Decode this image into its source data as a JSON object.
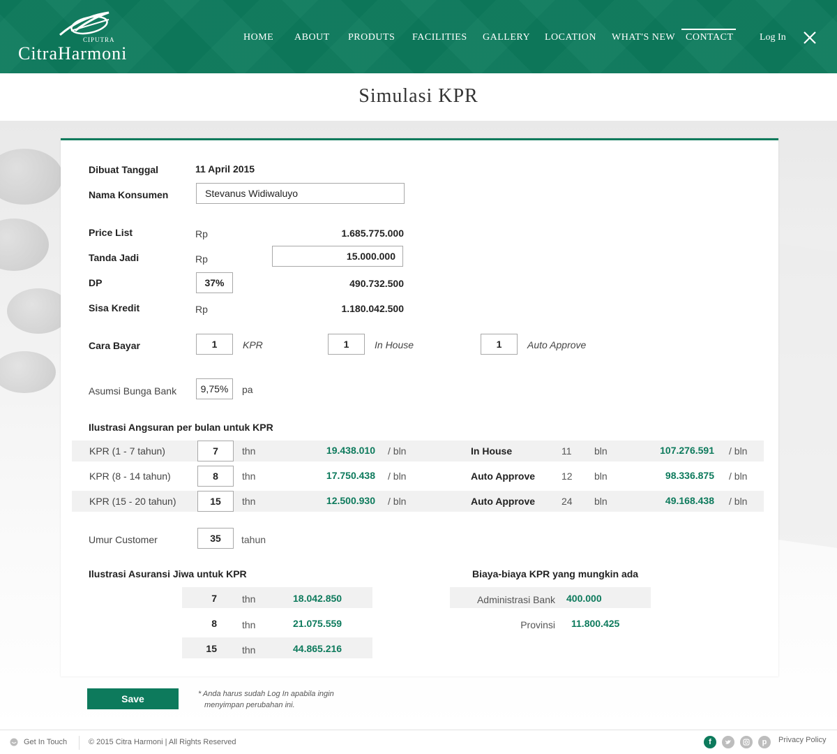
{
  "brand": {
    "small": "CIPUTRA",
    "name": "CitraHarmoni"
  },
  "nav": {
    "items": [
      {
        "label": "HOME"
      },
      {
        "label": "ABOUT"
      },
      {
        "label": "PRODUTS"
      },
      {
        "label": "FACILITIES"
      },
      {
        "label": "GALLERY"
      },
      {
        "label": "LOCATION"
      },
      {
        "label": "WHAT'S NEW"
      },
      {
        "label": "CONTACT"
      }
    ],
    "active": "CONTACT",
    "login": "Log In"
  },
  "page": {
    "title": "Simulasi KPR"
  },
  "form": {
    "date_label": "Dibuat Tanggal",
    "date_value": "11 April 2015",
    "customer_label": "Nama Konsumen",
    "customer_value": "Stevanus Widiwaluyo",
    "price_label": "Price List",
    "price_currency": "Rp",
    "price_value": "1.685.775.000",
    "booking_label": "Tanda Jadi",
    "booking_currency": "Rp",
    "booking_value": "15.000.000",
    "dp_label": "DP",
    "dp_percent": "37%",
    "dp_value": "490.732.500",
    "remaining_label": "Sisa Kredit",
    "remaining_currency": "Rp",
    "remaining_value": "1.180.042.500",
    "pay_label": "Cara Bayar",
    "pay_kpr_value": "1",
    "pay_kpr_label": "KPR",
    "pay_inhouse_value": "1",
    "pay_inhouse_label": "In House",
    "pay_auto_value": "1",
    "pay_auto_label": "Auto Approve",
    "interest_label": "Asumsi Bunga Bank",
    "interest_value": "9,75%",
    "interest_unit": "pa"
  },
  "installments": {
    "heading": "Ilustrasi Angsuran per bulan untuk KPR",
    "rows": [
      {
        "label": "KPR (1 - 7 tahun)",
        "years": "7",
        "unit": "thn",
        "amount": "19.438.010",
        "per": "/ bln",
        "alt_label": "In House",
        "alt_months": "11",
        "alt_unit": "bln",
        "alt_amount": "107.276.591",
        "alt_per": "/ bln"
      },
      {
        "label": "KPR (8 - 14 tahun)",
        "years": "8",
        "unit": "thn",
        "amount": "17.750.438",
        "per": "/ bln",
        "alt_label": "Auto Approve",
        "alt_months": "12",
        "alt_unit": "bln",
        "alt_amount": "98.336.875",
        "alt_per": "/ bln"
      },
      {
        "label": "KPR (15 - 20 tahun)",
        "years": "15",
        "unit": "thn",
        "amount": "12.500.930",
        "per": "/ bln",
        "alt_label": "Auto Approve",
        "alt_months": "24",
        "alt_unit": "bln",
        "alt_amount": "49.168.438",
        "alt_per": "/ bln"
      }
    ]
  },
  "age": {
    "label": "Umur Customer",
    "value": "35",
    "unit": "tahun"
  },
  "insurance": {
    "heading": "Ilustrasi Asuransi Jiwa untuk KPR",
    "rows": [
      {
        "years": "7",
        "unit": "thn",
        "amount": "18.042.850"
      },
      {
        "years": "8",
        "unit": "thn",
        "amount": "21.075.559"
      },
      {
        "years": "15",
        "unit": "thn",
        "amount": "44.865.216"
      }
    ]
  },
  "fees": {
    "heading": "Biaya-biaya KPR yang mungkin ada",
    "rows": [
      {
        "label": "Administrasi Bank",
        "amount": "400.000"
      },
      {
        "label": "Provinsi",
        "amount": "11.800.425"
      }
    ]
  },
  "actions": {
    "save_label": "Save",
    "note_line1": "* Anda harus sudah Log In apabila ingin",
    "note_line2": "menyimpan perubahan ini."
  },
  "footer": {
    "get_in_touch": "Get In Touch",
    "copyright": "© 2015 Citra Harmoni | All Rights Reserved",
    "privacy": "Privacy Policy",
    "social": [
      "facebook-icon",
      "twitter-icon",
      "instagram-icon",
      "pinterest-icon"
    ]
  },
  "colors": {
    "brand_green": "#0d7a5c",
    "value_green": "#0d7a5c",
    "stripe": "#f1f1f1"
  }
}
